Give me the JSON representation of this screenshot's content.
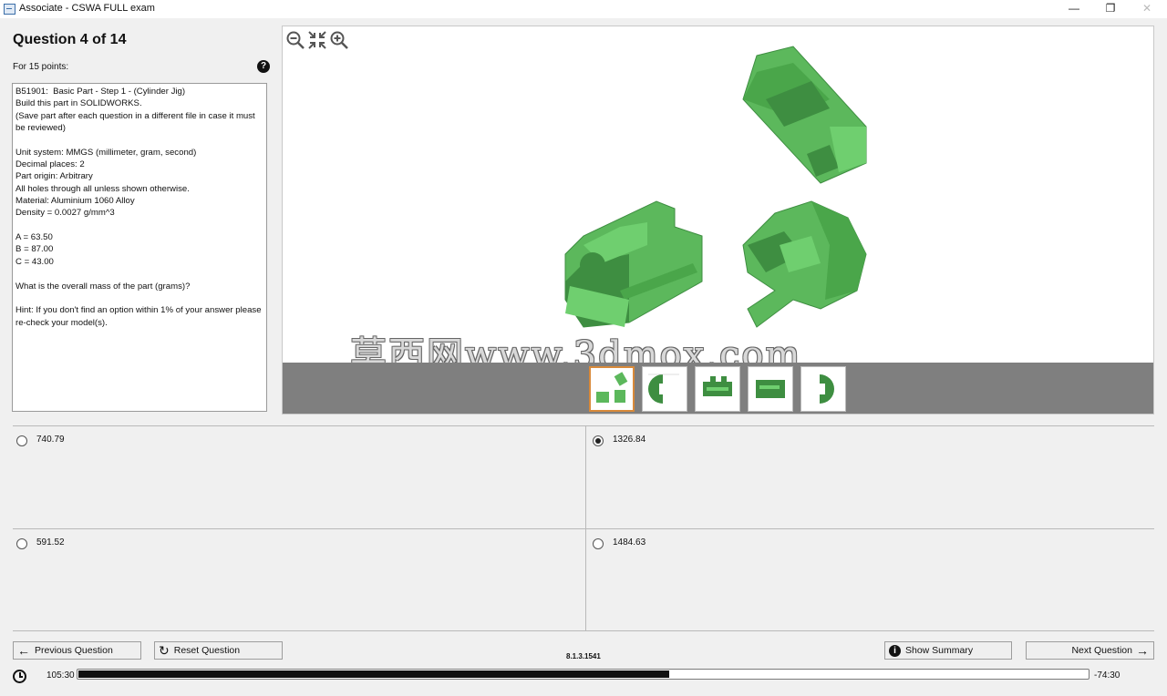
{
  "window": {
    "title": "Associate - CSWA FULL exam",
    "controls": [
      "minimize",
      "restore",
      "close"
    ]
  },
  "question": {
    "heading": "Question 4 of 14",
    "points": "For 15 points:",
    "lines": [
      "B51901:  Basic Part - Step 1 - (Cylinder Jig)",
      "Build this part in SOLIDWORKS.",
      "(Save part after each question in a different file in case it must be reviewed)",
      "",
      "Unit system: MMGS (millimeter, gram, second)",
      "Decimal places: 2",
      "Part origin: Arbitrary",
      "All holes through all unless shown otherwise.",
      "Material: Aluminium 1060 Alloy",
      "Density = 0.0027 g/mm^3",
      "",
      "A = 63.50",
      "B = 87.00",
      "C = 43.00",
      "",
      "What is the overall mass of the part (grams)?",
      "",
      "Hint: If you don't find an option within 1% of your answer please re-check your model(s)."
    ]
  },
  "viewer": {
    "tools": [
      "zoom-out-icon",
      "fit-icon",
      "zoom-in-icon"
    ],
    "watermark": "莫西网www.3dmox.com",
    "thumbnails": [
      "isometric-views",
      "side-view",
      "front-view",
      "top-view",
      "right-view"
    ],
    "active_thumbnail": 0
  },
  "answers": [
    {
      "label": "740.79",
      "selected": false
    },
    {
      "label": "1326.84",
      "selected": true
    },
    {
      "label": "591.52",
      "selected": false
    },
    {
      "label": "1484.63",
      "selected": false
    }
  ],
  "footer": {
    "previous": "Previous Question",
    "reset": "Reset Question",
    "version": "8.1.3.1541",
    "summary": "Show Summary",
    "next": "Next Question",
    "elapsed": "105:30",
    "remaining": "-74:30",
    "progress_fraction": 0.585
  },
  "colors": {
    "part_green": "#5cb85c",
    "part_dark": "#3e8e41",
    "thumb_active": "#d98a3a"
  }
}
